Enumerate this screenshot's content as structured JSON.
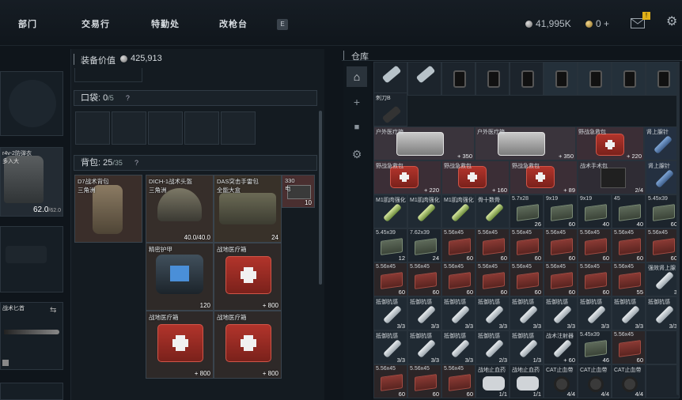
{
  "nav": {
    "tabs": [
      "部门",
      "交易行",
      "特勤处",
      "改枪台"
    ],
    "key_hint": "E"
  },
  "currency": {
    "silver": "41,995K",
    "gold": "0 +",
    "notification_badge": "!"
  },
  "equipment": {
    "armor_durability": "62.0",
    "armor_max": "/62.0",
    "armor_label": "r4v-2防弹衣\n多入大",
    "knife_label": "战术匕首"
  },
  "mid": {
    "value_label": "装备价值",
    "value": "425,913",
    "pocket_label": "口袋:",
    "pocket_value": "0",
    "pocket_max": "/5",
    "help": "?",
    "backpack_label": "背包:",
    "backpack_value": "25",
    "backpack_max": "/35",
    "items": [
      {
        "name": "D7战术背包\n三角洲",
        "count": ""
      },
      {
        "name": "DICH-1战术头盔\n三角洲",
        "count": "40.0/40.0"
      },
      {
        "name": "DAS突击手雷包\n全能大盒",
        "count": "24"
      },
      {
        "name": "330\n电",
        "count": "10"
      },
      {
        "name": "精密护甲",
        "count": "120"
      },
      {
        "name": "战地医疗箱",
        "count": "+ 800"
      },
      {
        "name": "战地医疗箱",
        "count": "+ 800"
      },
      {
        "name": "战地医疗箱",
        "count": "+ 800"
      }
    ]
  },
  "storage": {
    "title": "仓库",
    "row1_label": "刺刀B",
    "cells": [
      {
        "n": "户外医疗箱",
        "c": "+ 350"
      },
      {
        "n": "户外医疗箱",
        "c": "+ 350"
      },
      {
        "n": "野战急救包",
        "c": "+ 220"
      },
      {
        "n": "肾上腺针",
        "c": ""
      },
      {
        "n": "野战急救包",
        "c": "+ 220"
      },
      {
        "n": "野战急救包",
        "c": "+ 160"
      },
      {
        "n": "野战急救包",
        "c": "+ 89"
      },
      {
        "n": "战术手术包",
        "c": "2/4"
      },
      {
        "n": "肾上腺针",
        "c": ""
      },
      {
        "n": "M1肌肉强化",
        "c": ""
      },
      {
        "n": "M1肌肉强化",
        "c": ""
      },
      {
        "n": "M1肌肉强化",
        "c": ""
      },
      {
        "n": "骨十数骨",
        "c": ""
      },
      {
        "n": "5.7x28",
        "c": "26"
      },
      {
        "n": "9x19",
        "c": "60"
      },
      {
        "n": "9x19",
        "c": "40"
      },
      {
        "n": "45",
        "c": "40"
      },
      {
        "n": "5.45x39",
        "c": "60"
      },
      {
        "n": "5.45x39",
        "c": "12"
      },
      {
        "n": "7.62x39",
        "c": "24"
      },
      {
        "n": "5.56x45",
        "c": "60"
      },
      {
        "n": "5.56x45",
        "c": "60"
      },
      {
        "n": "5.56x45",
        "c": "60"
      },
      {
        "n": "5.56x45",
        "c": "60"
      },
      {
        "n": "5.56x45",
        "c": "60"
      },
      {
        "n": "5.56x45",
        "c": "60"
      },
      {
        "n": "5.56x45",
        "c": "60"
      },
      {
        "n": "5.56x45",
        "c": "60"
      },
      {
        "n": "5.56x45",
        "c": "60"
      },
      {
        "n": "5.56x45",
        "c": "60"
      },
      {
        "n": "5.56x45",
        "c": "60"
      },
      {
        "n": "5.56x45",
        "c": "60"
      },
      {
        "n": "5.56x45",
        "c": "60"
      },
      {
        "n": "5.56x45",
        "c": "60"
      },
      {
        "n": "5.56x45",
        "c": "55"
      },
      {
        "n": "强效肾上腺",
        "c": "3"
      },
      {
        "n": "抵御抗感",
        "c": "3/3"
      },
      {
        "n": "抵御抗感",
        "c": "3/3"
      },
      {
        "n": "抵御抗感",
        "c": "3/3"
      },
      {
        "n": "抵御抗感",
        "c": "3/3"
      },
      {
        "n": "抵御抗感",
        "c": "3/3"
      },
      {
        "n": "抵御抗感",
        "c": "3/3"
      },
      {
        "n": "抵御抗感",
        "c": "3/3"
      },
      {
        "n": "抵御抗感",
        "c": "3/3"
      },
      {
        "n": "抵御抗感",
        "c": "3/3"
      },
      {
        "n": "抵御抗感",
        "c": "3/3"
      },
      {
        "n": "抵御抗感",
        "c": "3/3"
      },
      {
        "n": "抵御抗感",
        "c": "3/3"
      },
      {
        "n": "抵御抗感",
        "c": "2/3"
      },
      {
        "n": "抵御抗感",
        "c": "1/3"
      },
      {
        "n": "战术注射器",
        "c": "+ 60"
      },
      {
        "n": "5.45x39",
        "c": "46"
      },
      {
        "n": "5.56x45",
        "c": "60"
      },
      {
        "n": "",
        "c": ""
      },
      {
        "n": "5.56x45",
        "c": "60"
      },
      {
        "n": "5.56x45",
        "c": "60"
      },
      {
        "n": "5.56x45",
        "c": "60"
      },
      {
        "n": "战地止血药",
        "c": "1/1"
      },
      {
        "n": "战地止血药",
        "c": "1/1"
      },
      {
        "n": "CAT止血带",
        "c": "4/4"
      },
      {
        "n": "CAT止血带",
        "c": "4/4"
      },
      {
        "n": "CAT止血带",
        "c": "4/4"
      },
      {
        "n": "",
        "c": ""
      }
    ]
  }
}
